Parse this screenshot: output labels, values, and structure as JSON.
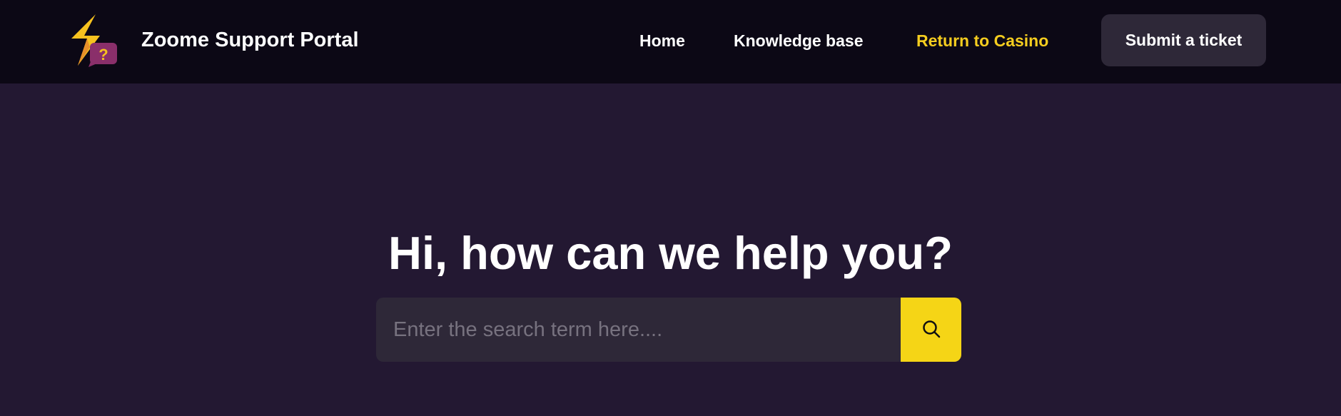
{
  "header": {
    "brand": "Zoome Support Portal",
    "logo_icon": "lightning-question-logo",
    "nav": {
      "home": "Home",
      "knowledge_base": "Knowledge base",
      "return_casino": "Return to Casino"
    },
    "submit_ticket": "Submit a ticket"
  },
  "hero": {
    "title": "Hi, how can we help you?",
    "search": {
      "placeholder": "Enter the search term here....",
      "value": "",
      "button_icon": "search-icon"
    }
  },
  "colors": {
    "background": "#231832",
    "header_background": "#0c0815",
    "accent_yellow": "#f5d516",
    "link_highlight": "#f5cd1f",
    "button_dark": "#2e2838"
  }
}
